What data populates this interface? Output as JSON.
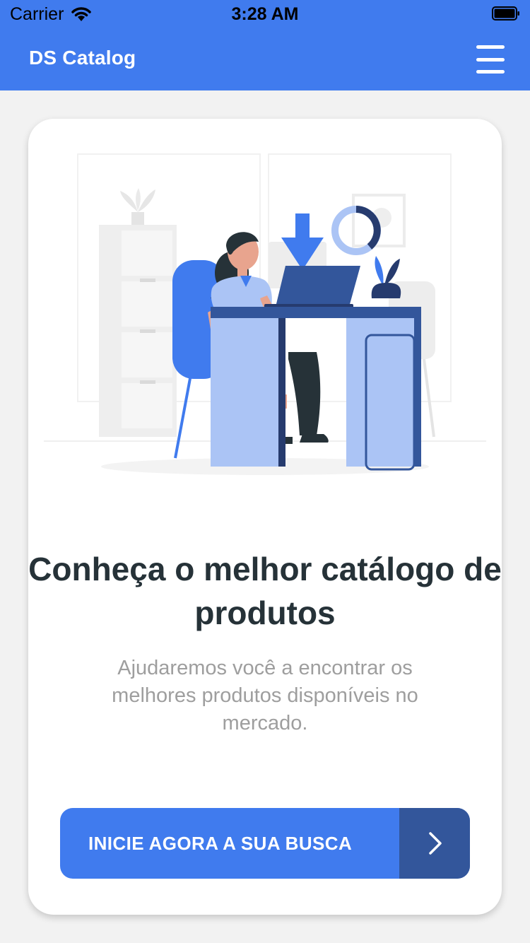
{
  "status_bar": {
    "carrier": "Carrier",
    "time": "3:28 AM",
    "wifi_icon": "wifi-icon",
    "battery_icon": "battery-icon"
  },
  "nav": {
    "title": "DS Catalog",
    "menu_icon": "hamburger-menu-icon"
  },
  "card": {
    "illustration": "woman-at-desk-illustration",
    "headline": "Conheça o melhor catálogo de produtos",
    "subtitle": "Ajudaremos você a encontrar os melhores produtos disponíveis no mercado.",
    "cta_label": "INICIE AGORA A SUA BUSCA",
    "cta_icon": "chevron-right-icon"
  },
  "colors": {
    "primary": "#407BEE",
    "primary_dark": "#33569B",
    "headline_text": "#263238",
    "subtitle_text": "#9E9E9E",
    "background": "#F2F2F2"
  }
}
